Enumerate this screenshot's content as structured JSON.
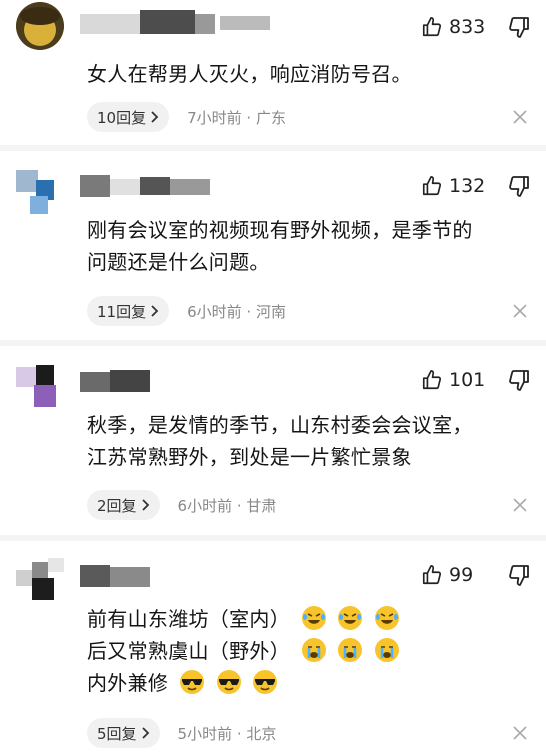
{
  "comments": [
    {
      "username": "",
      "likes": "833",
      "lines": [
        "女人在帮男人灭火，响应消防号召。"
      ],
      "emoji_lines": [],
      "reply_label": "10回复",
      "time_location": "7小时前 · 广东"
    },
    {
      "username": "",
      "likes": "132",
      "lines": [
        "刚有会议室的视频现有野外视频，是季节的",
        "问题还是什么问题。"
      ],
      "emoji_lines": [],
      "reply_label": "11回复",
      "time_location": "6小时前 · 河南"
    },
    {
      "username": "",
      "likes": "101",
      "lines": [
        "秋季，是发情的季节，山东村委会会议室，",
        "江苏常熟野外，到处是一片繁忙景象"
      ],
      "emoji_lines": [],
      "reply_label": "2回复",
      "time_location": "6小时前 · 甘肃"
    },
    {
      "username": "",
      "likes": "99",
      "lines": [
        "前有山东潍坊（室内）",
        "后又常熟虞山（野外）",
        "内外兼修"
      ],
      "emoji_lines": [
        "rofl-emoji",
        "sob-emoji",
        "sunglasses-emoji"
      ],
      "reply_label": "5回复",
      "time_location": "5小时前 · 北京"
    }
  ],
  "icons": {
    "like": "thumbs-up-icon",
    "dislike": "thumbs-down-icon",
    "close": "close-icon",
    "chevron": "chevron-right-icon"
  },
  "colors": {
    "text": "#151515",
    "meta": "#888888",
    "pill": "#f1f1f1",
    "separator": "#f4f4f4"
  }
}
